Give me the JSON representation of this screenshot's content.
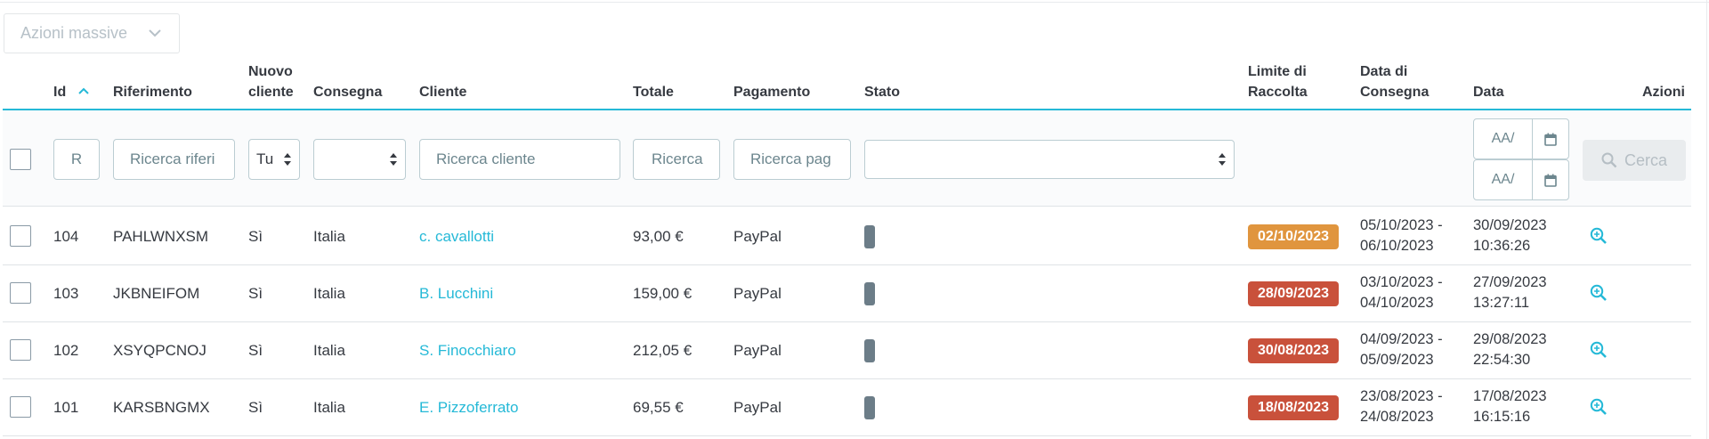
{
  "bulk_actions": {
    "label": "Azioni massive",
    "icon": "chevron-down-icon"
  },
  "columns": {
    "id": "Id",
    "riferimento": "Riferimento",
    "nuovo_cliente_1": "Nuovo",
    "nuovo_cliente_2": "cliente",
    "consegna": "Consegna",
    "cliente": "Cliente",
    "totale": "Totale",
    "pagamento": "Pagamento",
    "stato": "Stato",
    "limite_1": "Limite di",
    "limite_2": "Raccolta",
    "data_consegna_1": "Data di",
    "data_consegna_2": "Consegna",
    "data": "Data",
    "azioni": "Azioni"
  },
  "filters": {
    "id_placeholder": "R",
    "riferimento_placeholder": "Ricerca riferi",
    "nuovo_cliente_value": "Tu",
    "consegna_value": "",
    "cliente_placeholder": "Ricerca cliente",
    "totale_placeholder": "Ricerca",
    "pagamento_placeholder": "Ricerca pag",
    "stato_value": "",
    "date_from_placeholder": "AA/",
    "date_to_placeholder": "AA/",
    "search_label": "Cerca"
  },
  "colors": {
    "accent": "#25b9d7",
    "badge_orange": "#e0953e",
    "badge_red": "#c9513b",
    "status_grey": "#6c7d88"
  },
  "orders": [
    {
      "id": "104",
      "riferimento": "PAHLWNXSM",
      "nuovo_cliente": "Sì",
      "consegna": "Italia",
      "cliente": "c. cavallotti",
      "totale": "93,00 €",
      "pagamento": "PayPal",
      "limite": "02/10/2023",
      "limite_color": "orange",
      "consegna_da": "05/10/2023 -",
      "consegna_a": "06/10/2023",
      "data_giorno": "30/09/2023",
      "data_ora": "10:36:26"
    },
    {
      "id": "103",
      "riferimento": "JKBNEIFOM",
      "nuovo_cliente": "Sì",
      "consegna": "Italia",
      "cliente": "B. Lucchini",
      "totale": "159,00 €",
      "pagamento": "PayPal",
      "limite": "28/09/2023",
      "limite_color": "red",
      "consegna_da": "03/10/2023 -",
      "consegna_a": "04/10/2023",
      "data_giorno": "27/09/2023",
      "data_ora": "13:27:11"
    },
    {
      "id": "102",
      "riferimento": "XSYQPCNOJ",
      "nuovo_cliente": "Sì",
      "consegna": "Italia",
      "cliente": "S. Finocchiaro",
      "totale": "212,05 €",
      "pagamento": "PayPal",
      "limite": "30/08/2023",
      "limite_color": "red",
      "consegna_da": "04/09/2023 -",
      "consegna_a": "05/09/2023",
      "data_giorno": "29/08/2023",
      "data_ora": "22:54:30"
    },
    {
      "id": "101",
      "riferimento": "KARSBNGMX",
      "nuovo_cliente": "Sì",
      "consegna": "Italia",
      "cliente": "E. Pizzoferrato",
      "totale": "69,55 €",
      "pagamento": "PayPal",
      "limite": "18/08/2023",
      "limite_color": "red",
      "consegna_da": "23/08/2023 -",
      "consegna_a": "24/08/2023",
      "data_giorno": "17/08/2023",
      "data_ora": "16:15:16"
    }
  ]
}
